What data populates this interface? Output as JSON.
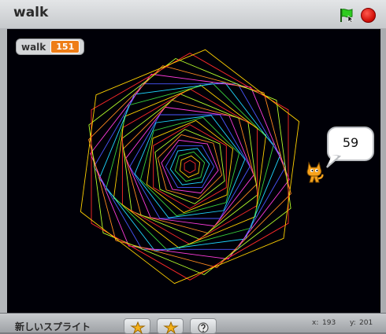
{
  "window": {
    "title": "walk"
  },
  "controls": {
    "flag_icon": "green-flag-icon",
    "stop_icon": "stop-sign-icon"
  },
  "monitor": {
    "name": "walk",
    "value": "151"
  },
  "speech": {
    "text": "59"
  },
  "sprite": {
    "name": "scratch-cat"
  },
  "bottom": {
    "label": "新しいスプライト",
    "buttons": [
      {
        "name": "paint-new-sprite-button",
        "icon": "star-paint-icon"
      },
      {
        "name": "choose-sprite-button",
        "icon": "star-folder-icon"
      },
      {
        "name": "surprise-sprite-button",
        "icon": "question-sprite-icon"
      }
    ],
    "x_label": "x:",
    "x_value": "193",
    "y_label": "y:",
    "y_value": "201"
  },
  "colors": {
    "stage_bg": "#000007",
    "monitor_value": "#ee7d16",
    "spiral_palette": [
      "#ff2a2a",
      "#ffd000",
      "#3ad13a",
      "#1fd7ff",
      "#4a57ff",
      "#ff3cdc",
      "#ff8a1e",
      "#b6ff2a"
    ]
  }
}
